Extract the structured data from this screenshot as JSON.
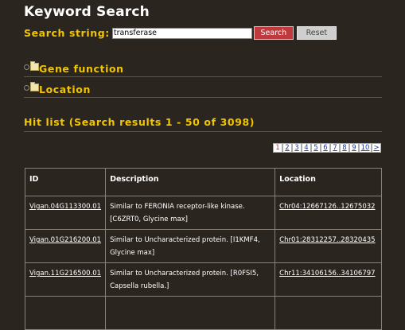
{
  "header": {
    "title": "Keyword Search"
  },
  "search": {
    "label": "Search string:",
    "value": "transferase",
    "search_button": "Search",
    "reset_button": "Reset"
  },
  "sections": [
    {
      "label": "Gene function"
    },
    {
      "label": "Location"
    }
  ],
  "hitlist": {
    "label": "Hit list (Search results 1 - 50 of 3098)"
  },
  "pager": {
    "pages": [
      "1",
      "2",
      "3",
      "4",
      "5",
      "6",
      "7",
      "8",
      "9",
      "10"
    ],
    "current": "1",
    "next": ">"
  },
  "table": {
    "columns": [
      "ID",
      "Description",
      "Location"
    ],
    "rows": [
      {
        "id": "Vigan.04G113300.01",
        "desc1": "Similar to FERONIA receptor-like kinase.",
        "desc2": "[C6ZRT0, Glycine max]",
        "location": "Chr04:12667126..12675032"
      },
      {
        "id": "Vigan.01G216200.01",
        "desc1": "Similar to Uncharacterized protein. [I1KMF4,",
        "desc2": "Glycine max]",
        "location": "Chr01:28312257..28320435"
      },
      {
        "id": "Vigan.11G216500.01",
        "desc1": "Similar to Uncharacterized protein. [R0FSI5,",
        "desc2": "Capsella rubella.]",
        "location": "Chr11:34106156..34106797"
      }
    ]
  },
  "colors": {
    "background": "#2b2520",
    "accent": "#f2c500",
    "search_button": "#c0393c"
  }
}
